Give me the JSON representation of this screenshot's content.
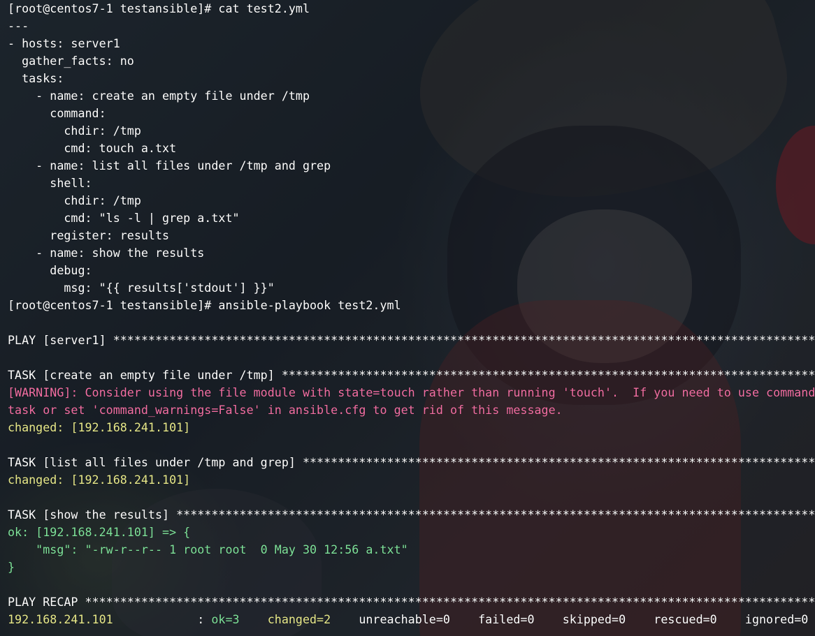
{
  "terminal": {
    "lines": [
      {
        "id": "line-1",
        "segments": [
          {
            "text": "[root@centos7-1 testansible]# cat test2.yml",
            "color": "white"
          }
        ]
      },
      {
        "id": "line-2",
        "segments": [
          {
            "text": "---",
            "color": "white"
          }
        ]
      },
      {
        "id": "line-3",
        "segments": [
          {
            "text": "- hosts: server1",
            "color": "white"
          }
        ]
      },
      {
        "id": "line-4",
        "segments": [
          {
            "text": "  gather_facts: no",
            "color": "white"
          }
        ]
      },
      {
        "id": "line-5",
        "segments": [
          {
            "text": "  tasks:",
            "color": "white"
          }
        ]
      },
      {
        "id": "line-6",
        "segments": [
          {
            "text": "    - name: create an empty file under /tmp",
            "color": "white"
          }
        ]
      },
      {
        "id": "line-7",
        "segments": [
          {
            "text": "      command:",
            "color": "white"
          }
        ]
      },
      {
        "id": "line-8",
        "segments": [
          {
            "text": "        chdir: /tmp",
            "color": "white"
          }
        ]
      },
      {
        "id": "line-9",
        "segments": [
          {
            "text": "        cmd: touch a.txt",
            "color": "white"
          }
        ]
      },
      {
        "id": "line-10",
        "segments": [
          {
            "text": "    - name: list all files under /tmp and grep",
            "color": "white"
          }
        ]
      },
      {
        "id": "line-11",
        "segments": [
          {
            "text": "      shell:",
            "color": "white"
          }
        ]
      },
      {
        "id": "line-12",
        "segments": [
          {
            "text": "        chdir: /tmp",
            "color": "white"
          }
        ]
      },
      {
        "id": "line-13",
        "segments": [
          {
            "text": "        cmd: \"ls -l | grep a.txt\"",
            "color": "white"
          }
        ]
      },
      {
        "id": "line-14",
        "segments": [
          {
            "text": "      register: results",
            "color": "white"
          }
        ]
      },
      {
        "id": "line-15",
        "segments": [
          {
            "text": "    - name: show the results",
            "color": "white"
          }
        ]
      },
      {
        "id": "line-16",
        "segments": [
          {
            "text": "      debug:",
            "color": "white"
          }
        ]
      },
      {
        "id": "line-17",
        "segments": [
          {
            "text": "        msg: \"{{ results['stdout'] }}\"",
            "color": "white"
          }
        ]
      },
      {
        "id": "line-18",
        "segments": [
          {
            "text": "[root@centos7-1 testansible]# ansible-playbook test2.yml",
            "color": "white"
          }
        ]
      },
      {
        "id": "line-19",
        "segments": [
          {
            "text": "",
            "color": "white"
          }
        ]
      },
      {
        "id": "line-20",
        "segments": [
          {
            "text": "PLAY [server1] ****************************************************************************************************",
            "color": "white"
          }
        ]
      },
      {
        "id": "line-21",
        "segments": [
          {
            "text": "",
            "color": "white"
          }
        ]
      },
      {
        "id": "line-22",
        "segments": [
          {
            "text": "TASK [create an empty file under /tmp] ****************************************************************************",
            "color": "white"
          }
        ]
      },
      {
        "id": "line-23",
        "segments": [
          {
            "text": "[WARNING]: Consider using the file module with state=touch rather than running 'touch'.  If you need to use command",
            "color": "pink"
          }
        ]
      },
      {
        "id": "line-24",
        "segments": [
          {
            "text": "task or set 'command_warnings=False' in ansible.cfg to get rid of this message.",
            "color": "pink"
          }
        ]
      },
      {
        "id": "line-25",
        "segments": [
          {
            "text": "changed: [192.168.241.101]",
            "color": "yellow"
          }
        ]
      },
      {
        "id": "line-26",
        "segments": [
          {
            "text": "",
            "color": "white"
          }
        ]
      },
      {
        "id": "line-27",
        "segments": [
          {
            "text": "TASK [list all files under /tmp and grep] *************************************************************************",
            "color": "white"
          }
        ]
      },
      {
        "id": "line-28",
        "segments": [
          {
            "text": "changed: [192.168.241.101]",
            "color": "yellow"
          }
        ]
      },
      {
        "id": "line-29",
        "segments": [
          {
            "text": "",
            "color": "white"
          }
        ]
      },
      {
        "id": "line-30",
        "segments": [
          {
            "text": "TASK [show the results] *******************************************************************************************",
            "color": "white"
          }
        ]
      },
      {
        "id": "line-31",
        "segments": [
          {
            "text": "ok: [192.168.241.101] => {",
            "color": "green"
          }
        ]
      },
      {
        "id": "line-32",
        "segments": [
          {
            "text": "    \"msg\": \"-rw-r--r-- 1 root root  0 May 30 12:56 a.txt\"",
            "color": "green"
          }
        ]
      },
      {
        "id": "line-33",
        "segments": [
          {
            "text": "}",
            "color": "green"
          }
        ]
      },
      {
        "id": "line-34",
        "segments": [
          {
            "text": "",
            "color": "white"
          }
        ]
      },
      {
        "id": "line-35",
        "segments": [
          {
            "text": "PLAY RECAP ********************************************************************************************************",
            "color": "white"
          }
        ]
      },
      {
        "id": "line-36",
        "segments": [
          {
            "text": "192.168.241.101",
            "color": "yellow"
          },
          {
            "text": "            : ",
            "color": "white"
          },
          {
            "text": "ok=3",
            "color": "green"
          },
          {
            "text": "    ",
            "color": "white"
          },
          {
            "text": "changed=2",
            "color": "yellow"
          },
          {
            "text": "    unreachable=0    failed=0    skipped=0    rescued=0    ignored=0",
            "color": "white"
          }
        ]
      }
    ]
  },
  "colors": {
    "white": "#ffffff",
    "yellow": "#e8e98a",
    "green": "#7fe39a",
    "pink": "#f36fa3"
  }
}
